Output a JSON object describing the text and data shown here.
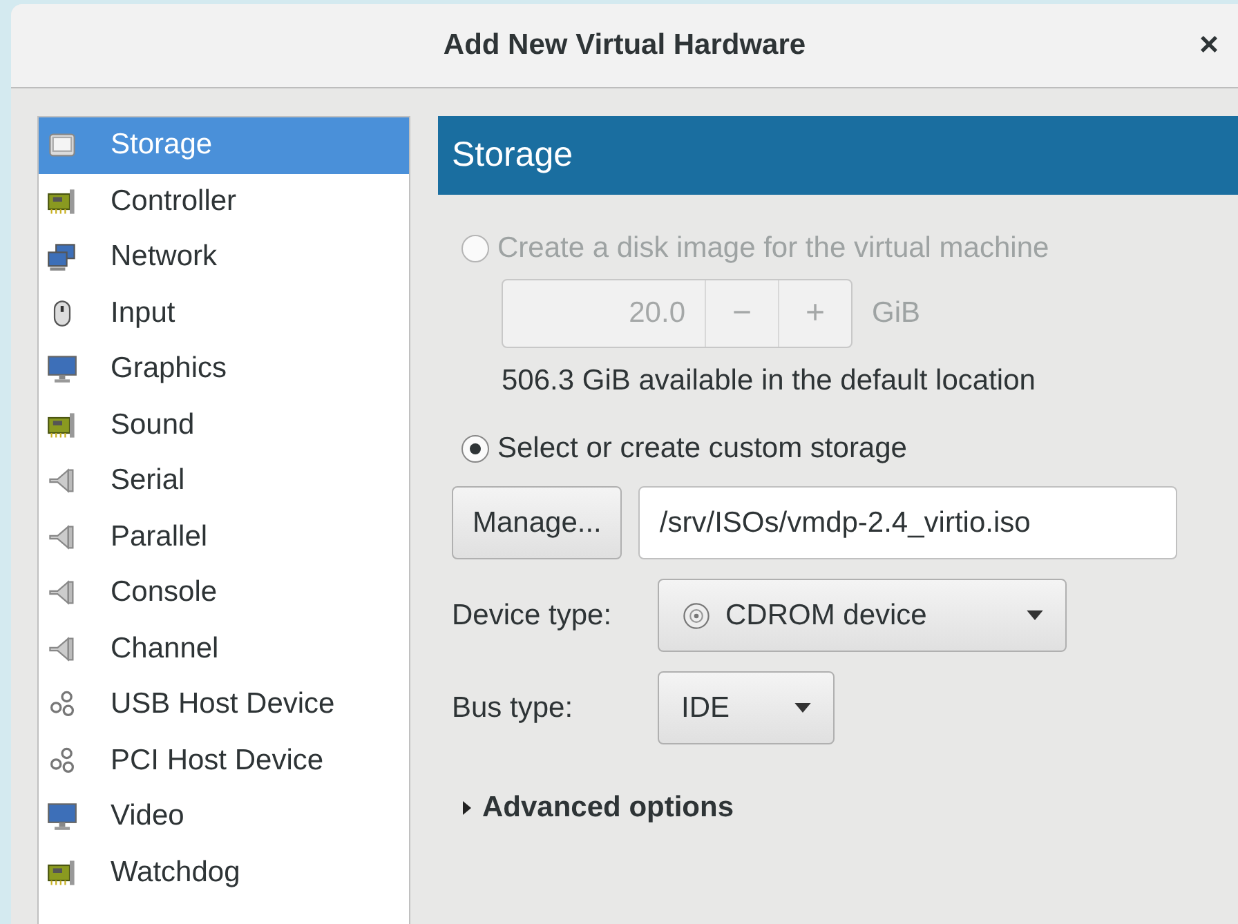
{
  "window": {
    "title": "Add New Virtual Hardware",
    "close": "×"
  },
  "sidebar": {
    "items": [
      {
        "label": "Storage",
        "kind": "disk",
        "selected": true
      },
      {
        "label": "Controller",
        "kind": "card",
        "selected": false
      },
      {
        "label": "Network",
        "kind": "network",
        "selected": false
      },
      {
        "label": "Input",
        "kind": "mouse",
        "selected": false
      },
      {
        "label": "Graphics",
        "kind": "monitor",
        "selected": false
      },
      {
        "label": "Sound",
        "kind": "card",
        "selected": false
      },
      {
        "label": "Serial",
        "kind": "plug",
        "selected": false
      },
      {
        "label": "Parallel",
        "kind": "plug",
        "selected": false
      },
      {
        "label": "Console",
        "kind": "plug",
        "selected": false
      },
      {
        "label": "Channel",
        "kind": "plug",
        "selected": false
      },
      {
        "label": "USB Host Device",
        "kind": "gears",
        "selected": false
      },
      {
        "label": "PCI Host Device",
        "kind": "gears",
        "selected": false
      },
      {
        "label": "Video",
        "kind": "monitor",
        "selected": false
      },
      {
        "label": "Watchdog",
        "kind": "card",
        "selected": false
      }
    ]
  },
  "panel": {
    "title": "Storage",
    "create_option": {
      "label": "Create a disk image for the virtual machine",
      "selected": false,
      "disabled": true
    },
    "size": {
      "value": "20.0",
      "minus": "−",
      "plus": "+",
      "unit": "GiB",
      "disabled": true
    },
    "available": "506.3 GiB available in the default location",
    "custom_option": {
      "label": "Select or create custom storage",
      "selected": true,
      "disabled": false
    },
    "manage_button": "Manage...",
    "path": "/srv/ISOs/vmdp-2.4_virtio.iso",
    "device_type": {
      "label": "Device type:",
      "value": "CDROM device"
    },
    "bus_type": {
      "label": "Bus type:",
      "value": "IDE"
    },
    "advanced": {
      "label": "Advanced options",
      "expanded": false
    }
  }
}
